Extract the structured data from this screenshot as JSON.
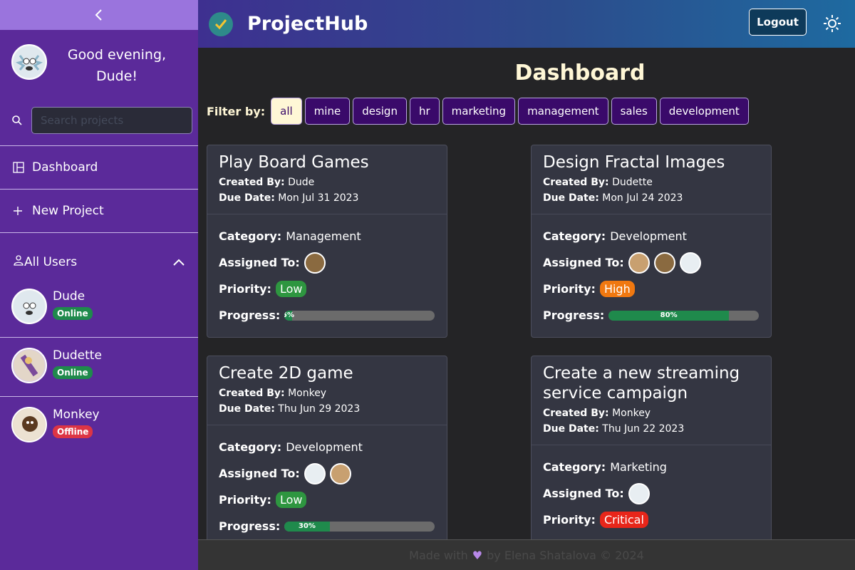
{
  "sidebar": {
    "greeting": "Good evening, Dude!",
    "search_placeholder": "Search projects",
    "nav": [
      {
        "label": "Dashboard"
      },
      {
        "label": "New Project"
      }
    ],
    "users_label": "All Users",
    "users": [
      {
        "name": "Dude",
        "status": "Online"
      },
      {
        "name": "Dudette",
        "status": "Online"
      },
      {
        "name": "Monkey",
        "status": "Offline"
      }
    ]
  },
  "header": {
    "brand": "ProjectHub",
    "logout_label": "Logout"
  },
  "main": {
    "title": "Dashboard",
    "filter_label": "Filter by:",
    "filters": [
      "all",
      "mine",
      "design",
      "hr",
      "marketing",
      "management",
      "sales",
      "development"
    ],
    "labels": {
      "created_by": "Created By:",
      "due_date": "Due Date:",
      "category": "Category:",
      "assigned_to": "Assigned To:",
      "priority": "Priority:",
      "progress": "Progress:"
    },
    "projects": [
      {
        "title": "Play Board Games",
        "created_by": "Dude",
        "due_date": "Mon Jul 31 2023",
        "category": "Management",
        "priority": "Low",
        "progress": 5,
        "progress_label": "5%"
      },
      {
        "title": "Design Fractal Images",
        "created_by": "Dudette",
        "due_date": "Mon Jul 24 2023",
        "category": "Development",
        "priority": "High",
        "progress": 80,
        "progress_label": "80%"
      },
      {
        "title": "Create 2D game",
        "created_by": "Monkey",
        "due_date": "Thu Jun 29 2023",
        "category": "Development",
        "priority": "Low",
        "progress": 30,
        "progress_label": "30%"
      },
      {
        "title": "Create a new streaming service campaign",
        "created_by": "Monkey",
        "due_date": "Thu Jun 22 2023",
        "category": "Marketing",
        "priority": "Critical"
      }
    ]
  },
  "footer": {
    "prefix": "Made with",
    "suffix": "by Elena Shatalova © 2024"
  },
  "colors": {
    "sidebar": "#5b2a9a",
    "accent": "#fff7d6",
    "online": "#1f8a4c",
    "offline": "#dc3545"
  }
}
